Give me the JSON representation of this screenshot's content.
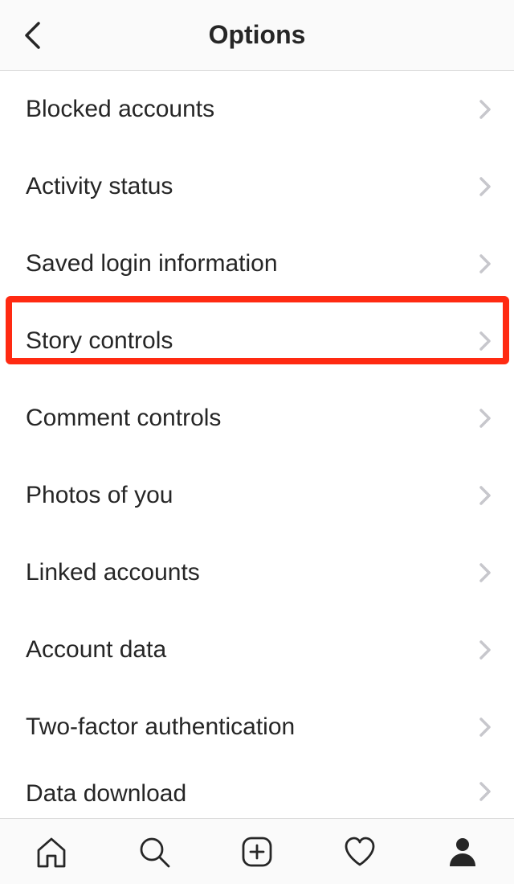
{
  "header": {
    "title": "Options"
  },
  "list": {
    "items": [
      {
        "label": "Blocked accounts",
        "name": "row-blocked-accounts"
      },
      {
        "label": "Activity status",
        "name": "row-activity-status"
      },
      {
        "label": "Saved login information",
        "name": "row-saved-login-information"
      },
      {
        "label": "Story controls",
        "name": "row-story-controls",
        "highlighted": true
      },
      {
        "label": "Comment controls",
        "name": "row-comment-controls"
      },
      {
        "label": "Photos of you",
        "name": "row-photos-of-you"
      },
      {
        "label": "Linked accounts",
        "name": "row-linked-accounts"
      },
      {
        "label": "Account data",
        "name": "row-account-data"
      },
      {
        "label": "Two-factor authentication",
        "name": "row-two-factor-authentication"
      },
      {
        "label": "Data download",
        "name": "row-data-download"
      }
    ]
  },
  "nav": {
    "items": [
      {
        "name": "home-icon"
      },
      {
        "name": "search-icon"
      },
      {
        "name": "add-post-icon"
      },
      {
        "name": "heart-icon"
      },
      {
        "name": "profile-icon"
      }
    ]
  },
  "colors": {
    "highlight": "#ff2a12",
    "text": "#262626",
    "chevron": "#c7c7cc",
    "divider": "#dbdbdb",
    "headerBg": "#fafafa"
  }
}
